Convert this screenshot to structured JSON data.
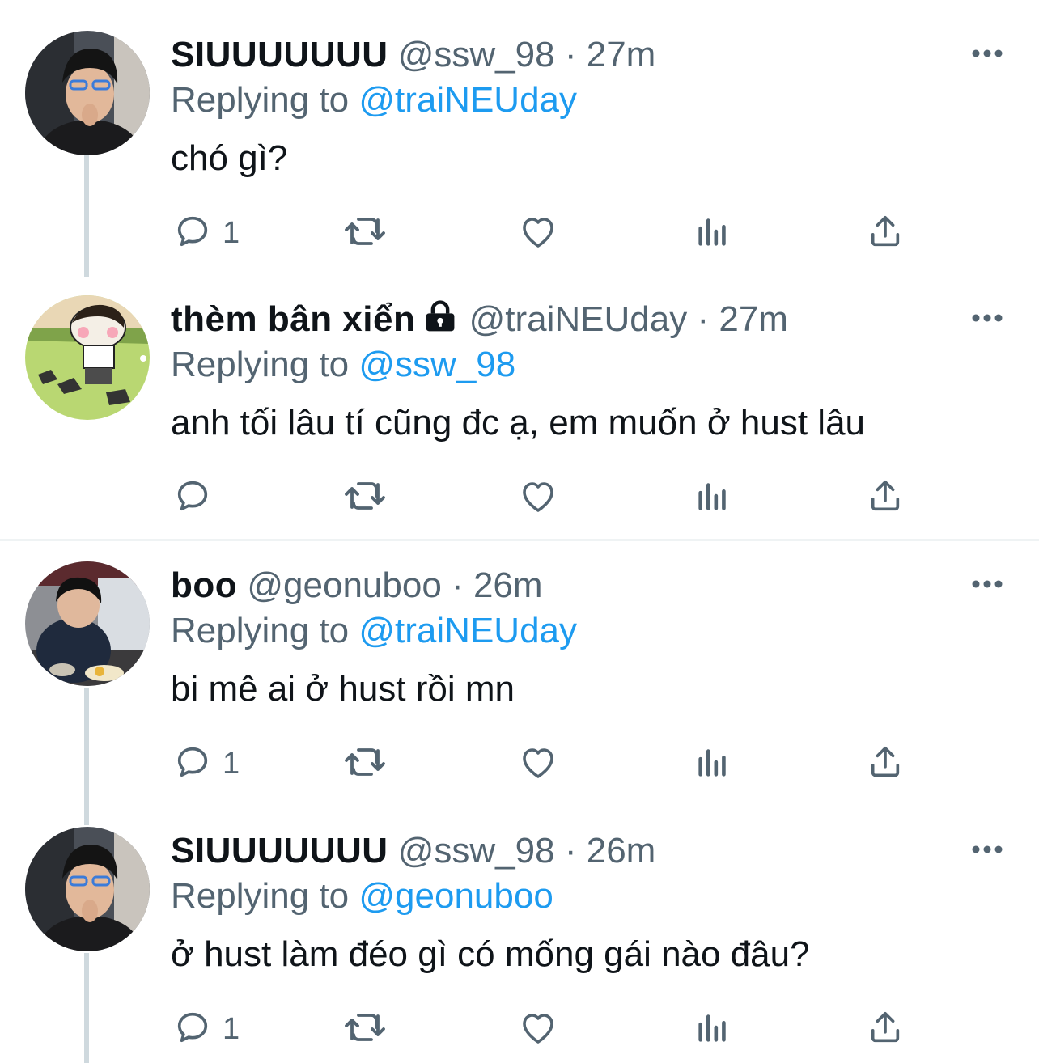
{
  "colors": {
    "accent": "#1d9bf0",
    "secondary_text": "#536471",
    "primary_text": "#0f1419",
    "thread_line": "#cfd9de"
  },
  "icons": {
    "reply": "reply-icon",
    "retweet": "retweet-icon",
    "like": "heart-icon",
    "views": "views-icon",
    "share": "share-icon",
    "more": "more-icon",
    "lock": "lock-icon"
  },
  "tweets": [
    {
      "name": "SIUUUUUUU",
      "handle": "@ssw_98",
      "separator": "·",
      "time": "27m",
      "replying_label": "Replying to",
      "replying_to": "@traiNEUday",
      "text": "chó gì?",
      "reply_count": "1"
    },
    {
      "name": "thèm bân xiển",
      "handle": "@traiNEUday",
      "separator": "·",
      "time": "27m",
      "replying_label": "Replying to",
      "replying_to": "@ssw_98",
      "text": "anh tối lâu tí cũng đc ạ, em muốn ở hust lâu",
      "reply_count": ""
    },
    {
      "name": "boo",
      "handle": "@geonuboo",
      "separator": "·",
      "time": "26m",
      "replying_label": "Replying to",
      "replying_to": "@traiNEUday",
      "text": "bi mê ai ở hust rồi mn",
      "reply_count": "1"
    },
    {
      "name": "SIUUUUUUU",
      "handle": "@ssw_98",
      "separator": "·",
      "time": "26m",
      "replying_label": "Replying to",
      "replying_to": "@geonuboo",
      "text": "ở hust làm đéo gì có mống gái nào đâu?",
      "reply_count": "1"
    }
  ]
}
